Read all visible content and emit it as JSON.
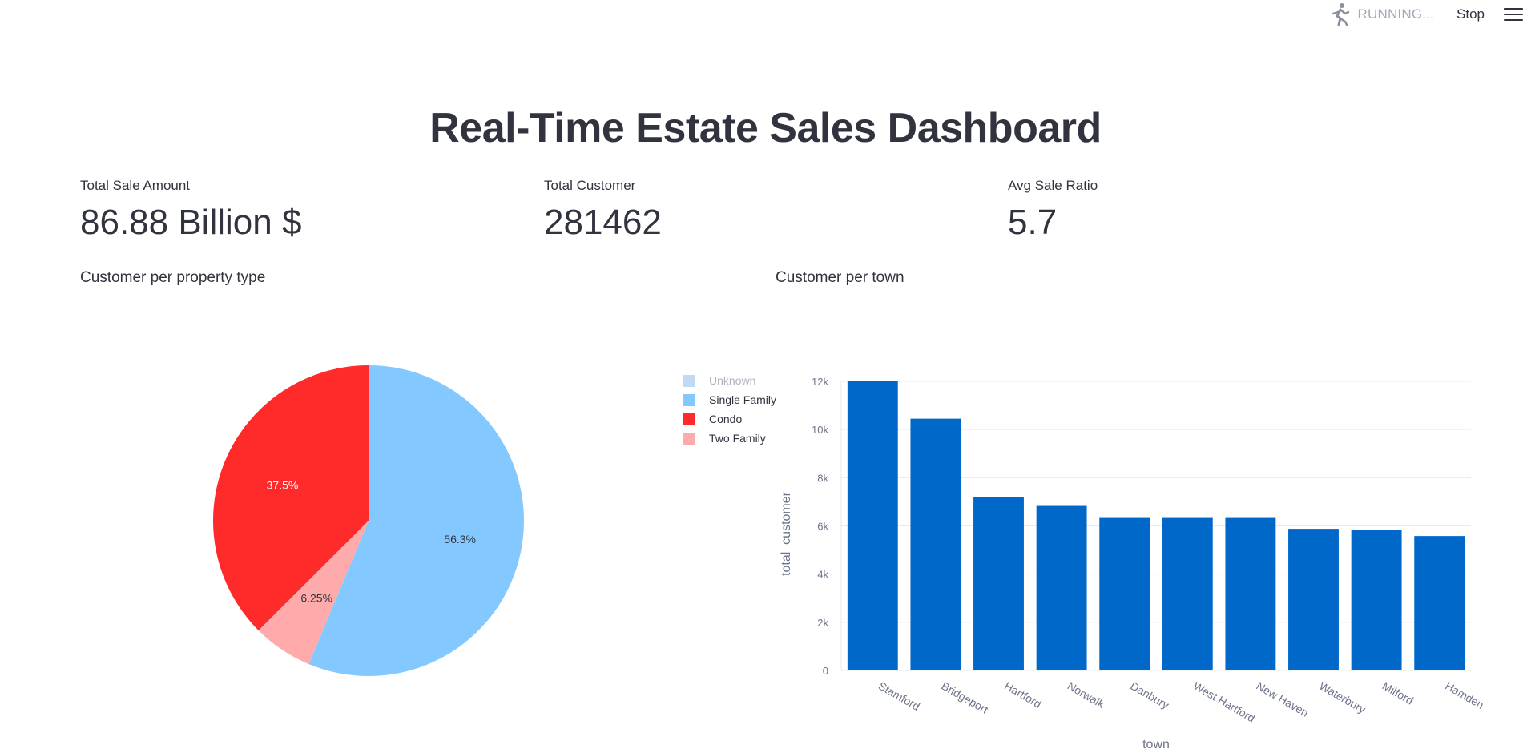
{
  "header": {
    "status_text": "RUNNING...",
    "stop_label": "Stop"
  },
  "page": {
    "title": "Real-Time Estate Sales Dashboard"
  },
  "metrics": [
    {
      "label": "Total Sale Amount",
      "value": "86.88 Billion $"
    },
    {
      "label": "Total Customer",
      "value": "281462"
    },
    {
      "label": "Avg Sale Ratio",
      "value": "5.7"
    }
  ],
  "sections": {
    "pie_title": "Customer per property type",
    "bar_title": "Customer per town"
  },
  "chart_data": [
    {
      "type": "pie",
      "title": "Customer per property type",
      "slices": [
        {
          "label": "Unknown",
          "value": 0,
          "color": "#83b5e8",
          "visible": false
        },
        {
          "label": "Single Family",
          "value": 56.3,
          "text": "56.3%",
          "color": "#83c9ff"
        },
        {
          "label": "Two Family",
          "value": 6.25,
          "text": "6.25%",
          "color": "#ffabab"
        },
        {
          "label": "Condo",
          "value": 37.5,
          "text": "37.5%",
          "color": "#ff2b2b"
        }
      ],
      "legend": [
        "Unknown",
        "Single Family",
        "Condo",
        "Two Family"
      ],
      "legend_position": "right"
    },
    {
      "type": "bar",
      "title": "Customer per town",
      "xlabel": "town",
      "ylabel": "total_customer",
      "categories": [
        "Stamford",
        "Bridgeport",
        "Hartford",
        "Norwalk",
        "Danbury",
        "West Hartford",
        "New Haven",
        "Waterbury",
        "Milford",
        "Hamden"
      ],
      "values": [
        12000,
        10450,
        7200,
        6830,
        6330,
        6330,
        6330,
        5880,
        5830,
        5580
      ],
      "ylim": [
        0,
        12000
      ],
      "yticks": [
        0,
        2000,
        4000,
        6000,
        8000,
        10000,
        12000
      ],
      "ytick_labels": [
        "0",
        "2k",
        "4k",
        "6k",
        "8k",
        "10k",
        "12k"
      ],
      "color": "#0068c9",
      "grid": true
    }
  ]
}
